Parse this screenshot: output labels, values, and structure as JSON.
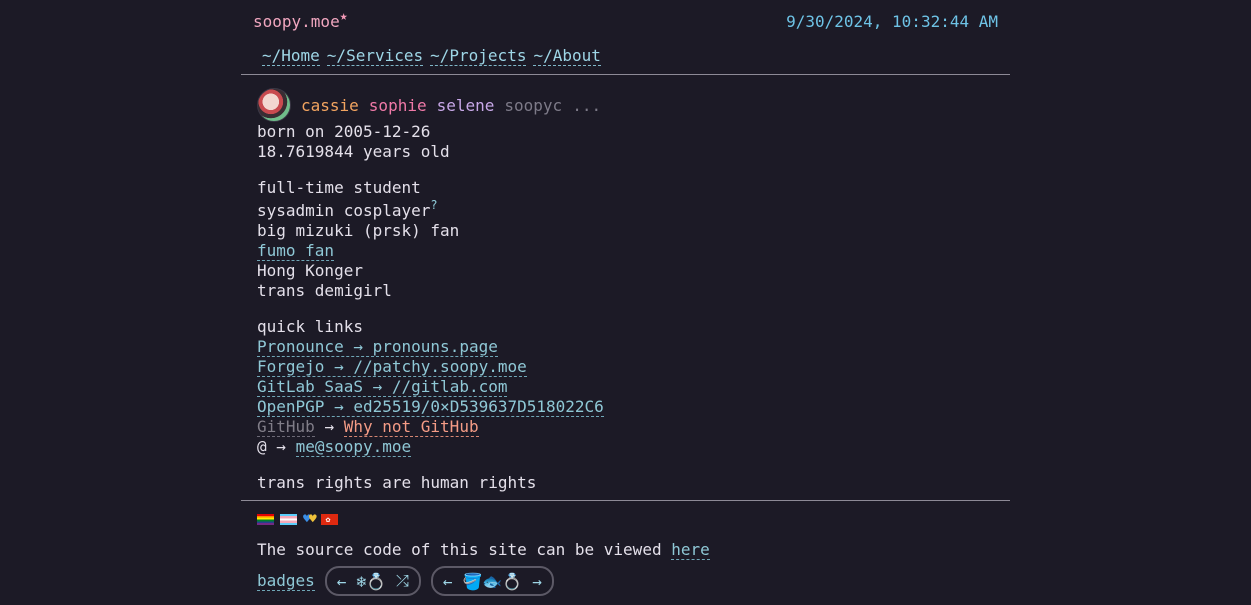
{
  "header": {
    "site_title": "soopy.moe",
    "star": "★",
    "datetime": "9/30/2024, 10:32:44 AM"
  },
  "nav": [
    "~/Home",
    "~/Services",
    "~/Projects",
    "~/About"
  ],
  "profile": {
    "names": [
      "cassie",
      "sophie",
      "selene",
      "soopyc",
      "..."
    ],
    "born": "born on 2005-12-26",
    "age": "18.7619844 years old",
    "traits": [
      "full-time student",
      "sysadmin cosplayer",
      "big mizuki (prsk) fan",
      "fumo fan",
      "Hong Konger",
      "trans demigirl"
    ],
    "sysadmin_mark": "?"
  },
  "quick_links": {
    "heading": "quick links",
    "arrow": "→",
    "items": [
      {
        "label": "Pronounce",
        "target": "pronouns.page"
      },
      {
        "label": "Forgejo",
        "target": "//patchy.soopy.moe"
      },
      {
        "label": "GitLab SaaS",
        "target": "//gitlab.com"
      },
      {
        "label": "OpenPGP",
        "target": "ed25519/0×D539637D518022C6"
      },
      {
        "label": "GitHub",
        "target": "Why not GitHub"
      },
      {
        "label": "@",
        "target": "me@soopy.moe"
      }
    ]
  },
  "slogan": "trans rights are human rights",
  "footer": {
    "source_text": "The source code of this site can be viewed",
    "source_link": "here",
    "badges_label": "badges",
    "webring1": {
      "prev": "←",
      "mid": "❄💍",
      "next": "⤮"
    },
    "webring2": {
      "prev": "←",
      "mid": "🪣🐟💍",
      "next": "→"
    }
  }
}
